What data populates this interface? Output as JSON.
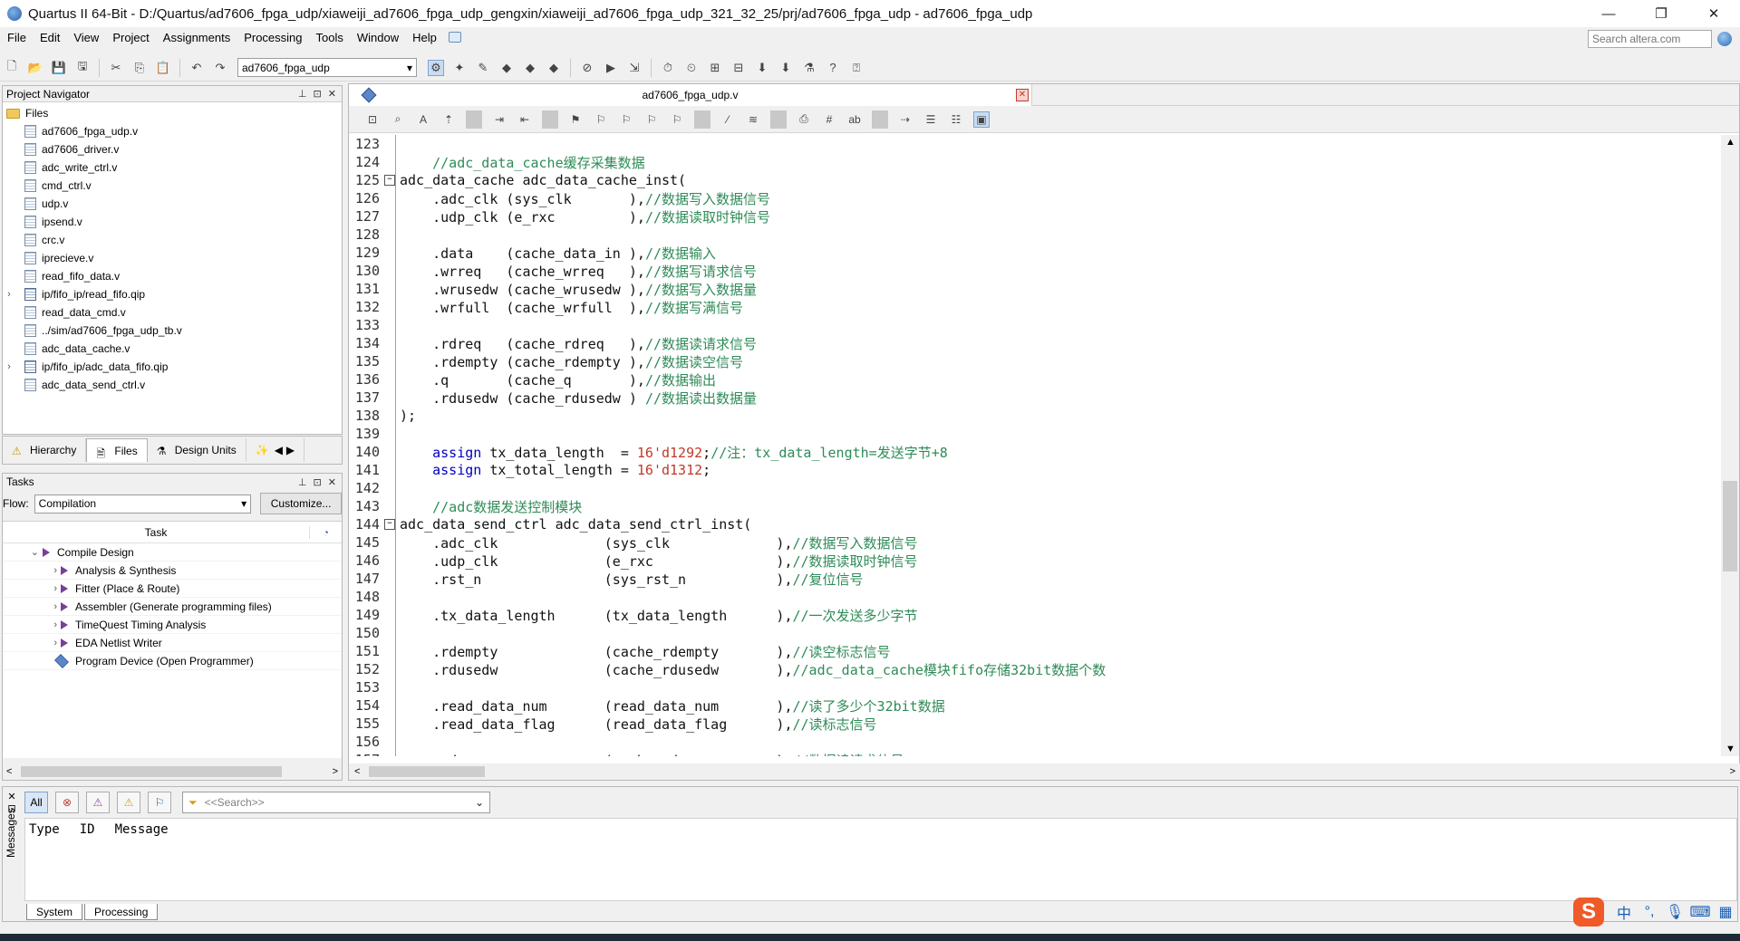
{
  "window": {
    "title": "Quartus II 64-Bit - D:/Quartus/ad7606_fpga_udp/xiaweiji_ad7606_fpga_udp_gengxin/xiaweiji_ad7606_fpga_udp_321_32_25/prj/ad7606_fpga_udp - ad7606_fpga_udp",
    "minimize": "—",
    "restore": "❐",
    "close": "✕"
  },
  "menu": [
    "File",
    "Edit",
    "View",
    "Project",
    "Assignments",
    "Processing",
    "Tools",
    "Window",
    "Help"
  ],
  "search": {
    "placeholder": "Search altera.com"
  },
  "toolbar": {
    "project": "ad7606_fpga_udp"
  },
  "project_navigator": {
    "title": "Project Navigator",
    "controls": "⊥ ⊡ ✕",
    "root": "Files",
    "files": [
      {
        "name": "ad7606_fpga_udp.v",
        "expandable": false
      },
      {
        "name": "ad7606_driver.v",
        "expandable": false
      },
      {
        "name": "adc_write_ctrl.v",
        "expandable": false
      },
      {
        "name": "cmd_ctrl.v",
        "expandable": false
      },
      {
        "name": "udp.v",
        "expandable": false
      },
      {
        "name": "ipsend.v",
        "expandable": false
      },
      {
        "name": "crc.v",
        "expandable": false
      },
      {
        "name": "iprecieve.v",
        "expandable": false
      },
      {
        "name": "read_fifo_data.v",
        "expandable": false
      },
      {
        "name": "ip/fifo_ip/read_fifo.qip",
        "expandable": true
      },
      {
        "name": "read_data_cmd.v",
        "expandable": false
      },
      {
        "name": "../sim/ad7606_fpga_udp_tb.v",
        "expandable": false
      },
      {
        "name": "adc_data_cache.v",
        "expandable": false
      },
      {
        "name": "ip/fifo_ip/adc_data_fifo.qip",
        "expandable": true
      },
      {
        "name": "adc_data_send_ctrl.v",
        "expandable": false
      }
    ],
    "tabs": [
      "Hierarchy",
      "Files",
      "Design Units"
    ]
  },
  "tasks": {
    "title": "Tasks",
    "controls": "⊥ ⊡ ✕",
    "flow_label": "Flow:",
    "flow_value": "Compilation",
    "customize": "Customize...",
    "column": "Task",
    "items": [
      {
        "label": "Compile Design",
        "level": 0
      },
      {
        "label": "Analysis & Synthesis",
        "level": 1
      },
      {
        "label": "Fitter (Place & Route)",
        "level": 1
      },
      {
        "label": "Assembler (Generate programming files)",
        "level": 1
      },
      {
        "label": "TimeQuest Timing Analysis",
        "level": 1
      },
      {
        "label": "EDA Netlist Writer",
        "level": 1
      }
    ],
    "program_device": "Program Device (Open Programmer)"
  },
  "editor": {
    "tab": "ad7606_fpga_udp.v",
    "lines": [
      {
        "n": "123",
        "t": ""
      },
      {
        "n": "124",
        "t": "    //adc_data_cache缓存采集数据"
      },
      {
        "n": "125",
        "t": "adc_data_cache adc_data_cache_inst("
      },
      {
        "n": "126",
        "t": "    .adc_clk (sys_clk       ),//数据写入数据信号"
      },
      {
        "n": "127",
        "t": "    .udp_clk (e_rxc         ),//数据读取时钟信号"
      },
      {
        "n": "128",
        "t": ""
      },
      {
        "n": "129",
        "t": "    .data    (cache_data_in ),//数据输入"
      },
      {
        "n": "130",
        "t": "    .wrreq   (cache_wrreq   ),//数据写请求信号"
      },
      {
        "n": "131",
        "t": "    .wrusedw (cache_wrusedw ),//数据写入数据量"
      },
      {
        "n": "132",
        "t": "    .wrfull  (cache_wrfull  ),//数据写满信号"
      },
      {
        "n": "133",
        "t": ""
      },
      {
        "n": "134",
        "t": "    .rdreq   (cache_rdreq   ),//数据读请求信号"
      },
      {
        "n": "135",
        "t": "    .rdempty (cache_rdempty ),//数据读空信号"
      },
      {
        "n": "136",
        "t": "    .q       (cache_q       ),//数据输出"
      },
      {
        "n": "137",
        "t": "    .rdusedw (cache_rdusedw ) //数据读出数据量"
      },
      {
        "n": "138",
        "t": ");"
      },
      {
        "n": "139",
        "t": ""
      },
      {
        "n": "140",
        "t": "    assign tx_data_length  = 16'd1292;//注：tx_data_length=发送字节+8"
      },
      {
        "n": "141",
        "t": "    assign tx_total_length = 16'd1312;"
      },
      {
        "n": "142",
        "t": ""
      },
      {
        "n": "143",
        "t": "    //adc数据发送控制模块"
      },
      {
        "n": "144",
        "t": "adc_data_send_ctrl adc_data_send_ctrl_inst("
      },
      {
        "n": "145",
        "t": "    .adc_clk             (sys_clk             ),//数据写入数据信号"
      },
      {
        "n": "146",
        "t": "    .udp_clk             (e_rxc               ),//数据读取时钟信号"
      },
      {
        "n": "147",
        "t": "    .rst_n               (sys_rst_n           ),//复位信号"
      },
      {
        "n": "148",
        "t": ""
      },
      {
        "n": "149",
        "t": "    .tx_data_length      (tx_data_length      ),//一次发送多少字节"
      },
      {
        "n": "150",
        "t": ""
      },
      {
        "n": "151",
        "t": "    .rdempty             (cache_rdempty       ),//读空标志信号"
      },
      {
        "n": "152",
        "t": "    .rdusedw             (cache_rdusedw       ),//adc_data_cache模块fifo存储32bit数据个数"
      },
      {
        "n": "153",
        "t": ""
      },
      {
        "n": "154",
        "t": "    .read_data_num       (read_data_num       ),//读了多少个32bit数据"
      },
      {
        "n": "155",
        "t": "    .read_data_flag      (read_data_flag      ),//读标志信号"
      },
      {
        "n": "156",
        "t": ""
      },
      {
        "n": "157",
        "t": "    .rdreq               (cache_rdreq         ),//数据读请求信号"
      }
    ]
  },
  "messages": {
    "side_label": "Messages",
    "filter_all": "All",
    "search_placeholder": "<<Search>>",
    "columns": [
      "Type",
      "ID",
      "Message"
    ],
    "tabs": [
      "System",
      "Processing"
    ]
  },
  "ime": {
    "logo": "S",
    "lang": "中",
    "punct": "°,",
    "mic": "🎙",
    "keyboard": "⌨",
    "grid": "▦"
  }
}
